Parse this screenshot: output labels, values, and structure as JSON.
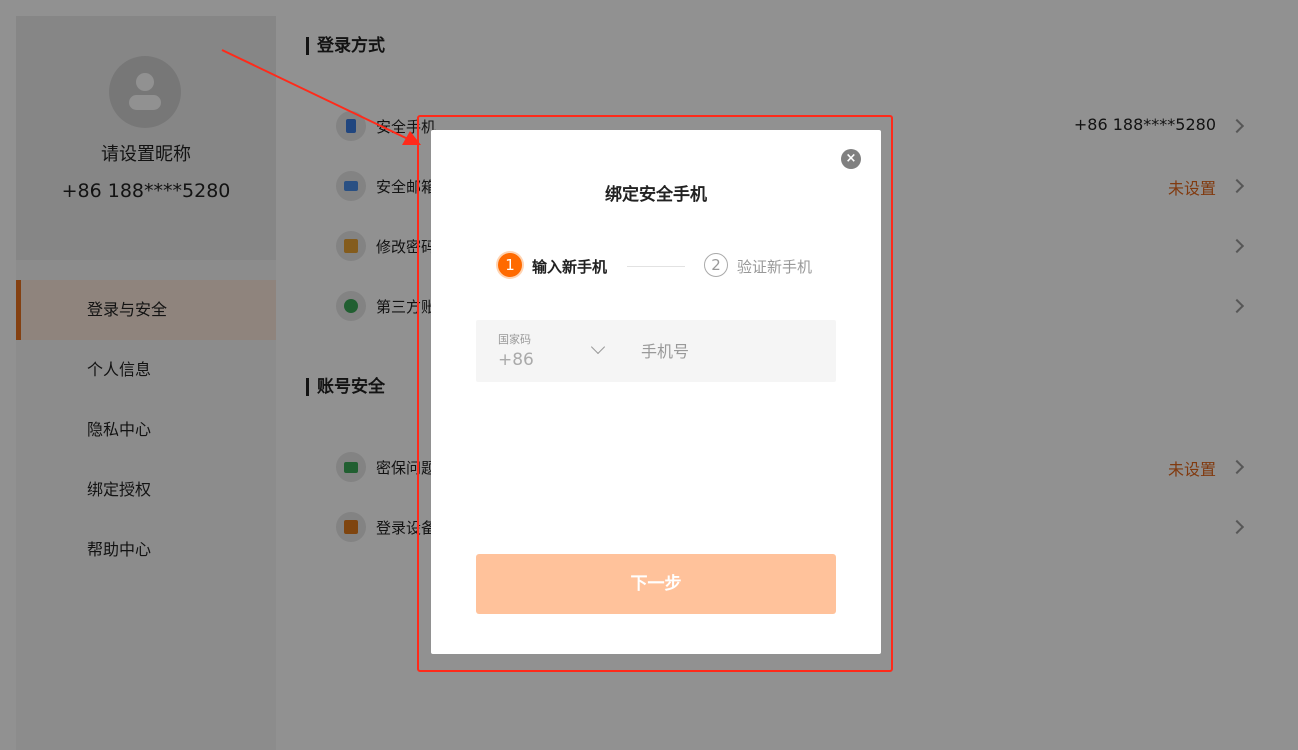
{
  "sidebar": {
    "nickname": "请设置昵称",
    "phone": "+86 188****5280",
    "items": [
      {
        "label": "登录与安全",
        "active": true
      },
      {
        "label": "个人信息"
      },
      {
        "label": "隐私中心"
      },
      {
        "label": "绑定授权"
      },
      {
        "label": "帮助中心"
      }
    ]
  },
  "login_methods": {
    "title": "登录方式",
    "rows": [
      {
        "label": "安全手机",
        "value": "+86 188****5280",
        "icon": "phone-icon"
      },
      {
        "label": "安全邮箱",
        "value": "未设置",
        "icon": "mail-icon"
      },
      {
        "label": "修改密码",
        "value": "",
        "icon": "lock-icon"
      },
      {
        "label": "第三方账号",
        "value": "",
        "icon": "user-icon"
      }
    ]
  },
  "account_security": {
    "title": "账号安全",
    "rows": [
      {
        "label": "密保问题",
        "value": "未设置",
        "icon": "card-icon"
      },
      {
        "label": "登录设备",
        "value": "",
        "icon": "question-icon"
      }
    ]
  },
  "modal": {
    "title": "绑定安全手机",
    "close_icon": "×",
    "steps": [
      {
        "num": "1",
        "label": "输入新手机"
      },
      {
        "num": "2",
        "label": "验证新手机"
      }
    ],
    "country_code_label": "国家码",
    "country_code_value": "+86",
    "phone_placeholder": "手机号",
    "next_label": "下一步"
  },
  "colors": {
    "accent": "#ff6a00",
    "warning_text": "#e3671c",
    "annotation": "#ff2a1a",
    "next_disabled": "#ffc29b"
  }
}
